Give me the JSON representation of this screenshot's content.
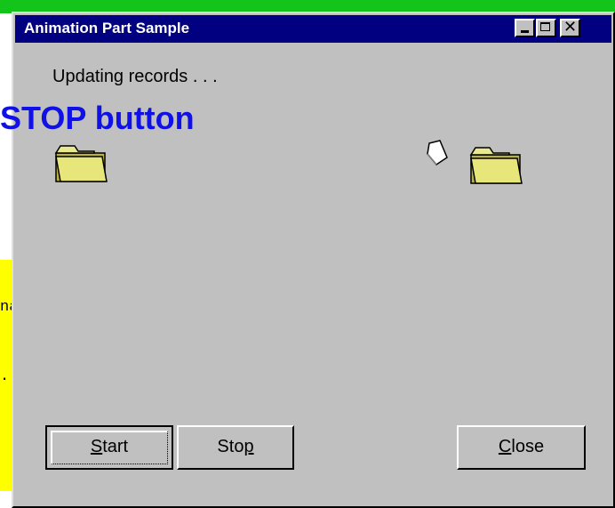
{
  "window": {
    "title": "Animation Part Sample",
    "status": "Updating records . . ."
  },
  "buttons": {
    "start": {
      "pre": "",
      "mnemonic": "S",
      "post": "tart"
    },
    "stop": {
      "pre": "Sto",
      "mnemonic": "p",
      "post": ""
    },
    "close": {
      "pre": "",
      "mnemonic": "C",
      "post": "lose"
    }
  },
  "slide": {
    "overlay_title": "STOP button",
    "fragment1": "na",
    "fragment2": "."
  },
  "icons": [
    "folder-icon",
    "paper-icon",
    "folder-icon",
    "minimize-icon",
    "maximize-icon",
    "close-icon"
  ],
  "colors": {
    "titlebar": "#000080",
    "window_face": "#c0c0c0",
    "overlay_text": "#1010e8",
    "slide_green": "#13c51b",
    "slide_yellow": "#ffff00"
  }
}
